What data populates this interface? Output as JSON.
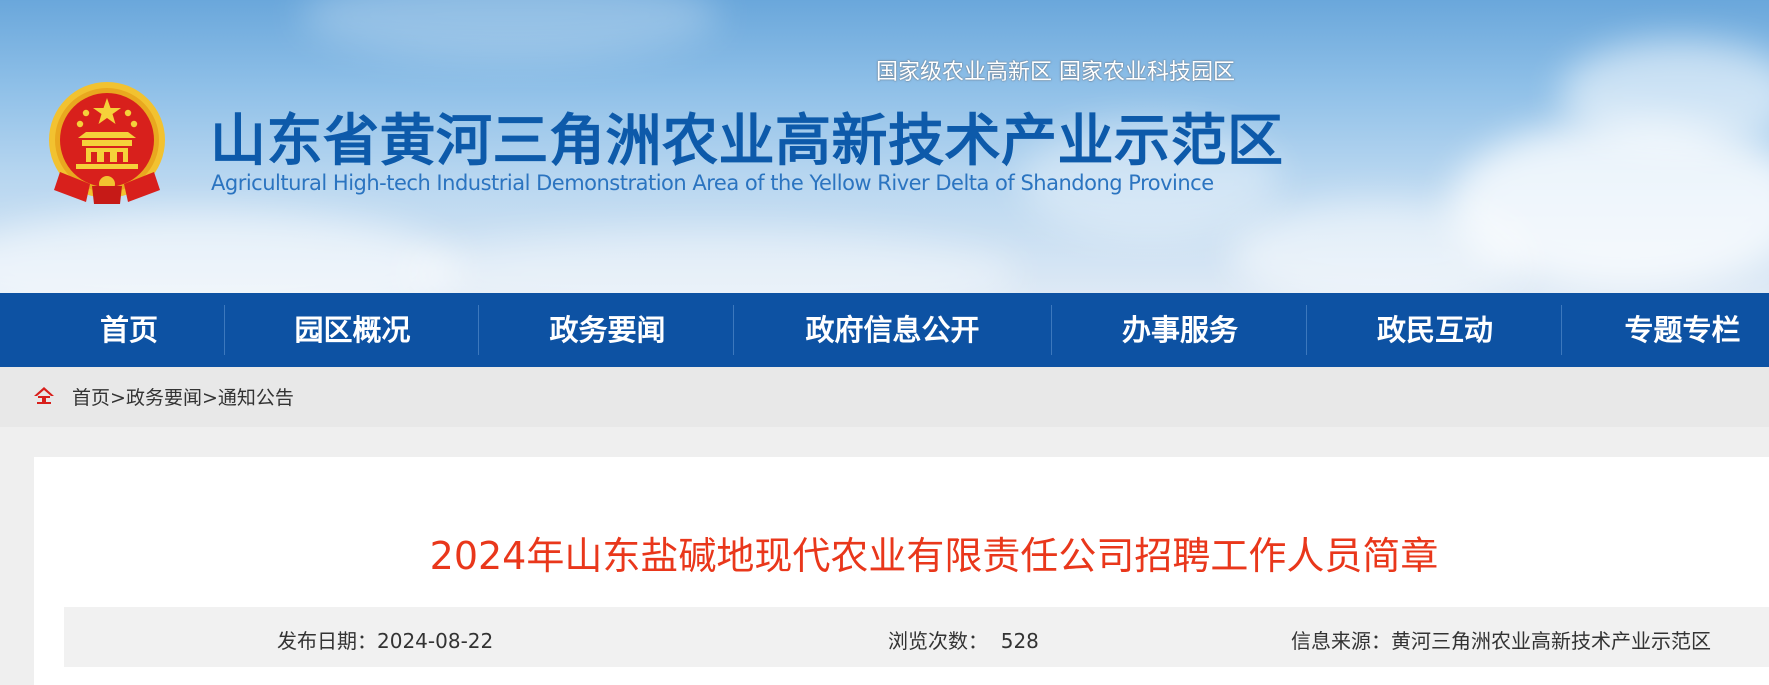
{
  "header": {
    "tags": "国家级农业高新区  国家农业科技园区",
    "title": "山东省黄河三角洲农业高新技术产业示范区",
    "title_en": "Agricultural High-tech Industrial Demonstration Area of the Yellow River Delta of Shandong Province"
  },
  "nav": {
    "items": [
      {
        "label": "首页"
      },
      {
        "label": "园区概况"
      },
      {
        "label": "政务要闻"
      },
      {
        "label": "政府信息公开"
      },
      {
        "label": "办事服务"
      },
      {
        "label": "政民互动"
      },
      {
        "label": "专题专栏"
      }
    ]
  },
  "breadcrumb": {
    "items": [
      "首页",
      "政务要闻",
      "通知公告"
    ],
    "separator": ">"
  },
  "article": {
    "title": "2024年山东盐碱地现代农业有限责任公司招聘工作人员简章",
    "publish_date": "发布日期：2024-08-22",
    "views_label": "浏览次数：",
    "views_value": "528",
    "source": "信息来源：黄河三角洲农业高新技术产业示范区"
  },
  "colors": {
    "nav_bg": "#0d52a3",
    "title_blue": "#0d5aaa",
    "article_title_red": "#e9371b",
    "emblem_red": "#d8201c",
    "emblem_gold": "#f2c230"
  },
  "icons": {
    "emblem": "national-emblem-icon",
    "home": "home-icon"
  }
}
